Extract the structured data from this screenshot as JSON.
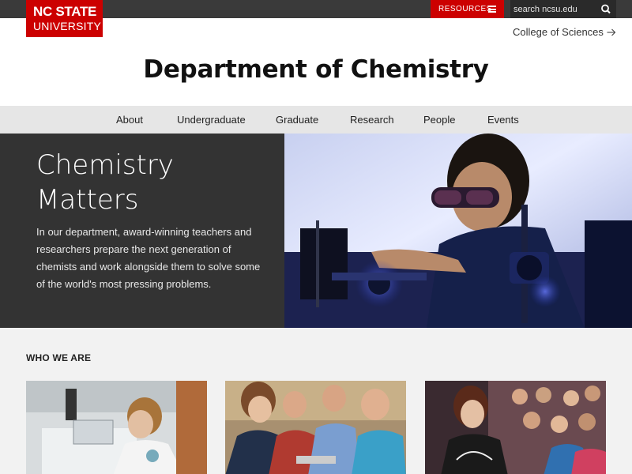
{
  "brand": {
    "line1": "NC STATE",
    "line2": "UNIVERSITY",
    "color": "#cc0000"
  },
  "topbar": {
    "resources_label": "RESOURCES",
    "search_placeholder": "search ncsu.edu"
  },
  "header": {
    "college_link": "College of Sciences",
    "department_title": "Department of Chemistry"
  },
  "nav": {
    "items": [
      {
        "label": "About"
      },
      {
        "label": "Undergraduate"
      },
      {
        "label": "Graduate"
      },
      {
        "label": "Research"
      },
      {
        "label": "People"
      },
      {
        "label": "Events"
      }
    ]
  },
  "hero": {
    "title_line1": "Chemistry",
    "title_line2": "Matters",
    "body": "In our department, award-winning teachers and researchers prepare the next generation of chemists and work alongside them to solve some of the world's most pressing problems."
  },
  "who_we_are": {
    "heading": "WHO WE ARE"
  }
}
